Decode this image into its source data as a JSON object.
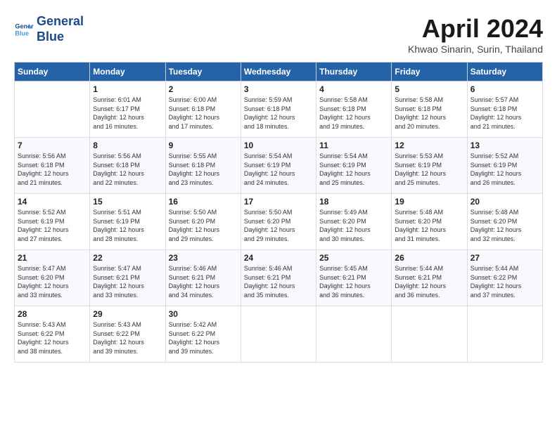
{
  "header": {
    "logo_line1": "General",
    "logo_line2": "Blue",
    "month_title": "April 2024",
    "subtitle": "Khwao Sinarin, Surin, Thailand"
  },
  "days_of_week": [
    "Sunday",
    "Monday",
    "Tuesday",
    "Wednesday",
    "Thursday",
    "Friday",
    "Saturday"
  ],
  "weeks": [
    [
      {
        "day": "",
        "detail": ""
      },
      {
        "day": "1",
        "detail": "Sunrise: 6:01 AM\nSunset: 6:17 PM\nDaylight: 12 hours\nand 16 minutes."
      },
      {
        "day": "2",
        "detail": "Sunrise: 6:00 AM\nSunset: 6:18 PM\nDaylight: 12 hours\nand 17 minutes."
      },
      {
        "day": "3",
        "detail": "Sunrise: 5:59 AM\nSunset: 6:18 PM\nDaylight: 12 hours\nand 18 minutes."
      },
      {
        "day": "4",
        "detail": "Sunrise: 5:58 AM\nSunset: 6:18 PM\nDaylight: 12 hours\nand 19 minutes."
      },
      {
        "day": "5",
        "detail": "Sunrise: 5:58 AM\nSunset: 6:18 PM\nDaylight: 12 hours\nand 20 minutes."
      },
      {
        "day": "6",
        "detail": "Sunrise: 5:57 AM\nSunset: 6:18 PM\nDaylight: 12 hours\nand 21 minutes."
      }
    ],
    [
      {
        "day": "7",
        "detail": "Sunrise: 5:56 AM\nSunset: 6:18 PM\nDaylight: 12 hours\nand 21 minutes."
      },
      {
        "day": "8",
        "detail": "Sunrise: 5:56 AM\nSunset: 6:18 PM\nDaylight: 12 hours\nand 22 minutes."
      },
      {
        "day": "9",
        "detail": "Sunrise: 5:55 AM\nSunset: 6:18 PM\nDaylight: 12 hours\nand 23 minutes."
      },
      {
        "day": "10",
        "detail": "Sunrise: 5:54 AM\nSunset: 6:19 PM\nDaylight: 12 hours\nand 24 minutes."
      },
      {
        "day": "11",
        "detail": "Sunrise: 5:54 AM\nSunset: 6:19 PM\nDaylight: 12 hours\nand 25 minutes."
      },
      {
        "day": "12",
        "detail": "Sunrise: 5:53 AM\nSunset: 6:19 PM\nDaylight: 12 hours\nand 25 minutes."
      },
      {
        "day": "13",
        "detail": "Sunrise: 5:52 AM\nSunset: 6:19 PM\nDaylight: 12 hours\nand 26 minutes."
      }
    ],
    [
      {
        "day": "14",
        "detail": "Sunrise: 5:52 AM\nSunset: 6:19 PM\nDaylight: 12 hours\nand 27 minutes."
      },
      {
        "day": "15",
        "detail": "Sunrise: 5:51 AM\nSunset: 6:19 PM\nDaylight: 12 hours\nand 28 minutes."
      },
      {
        "day": "16",
        "detail": "Sunrise: 5:50 AM\nSunset: 6:20 PM\nDaylight: 12 hours\nand 29 minutes."
      },
      {
        "day": "17",
        "detail": "Sunrise: 5:50 AM\nSunset: 6:20 PM\nDaylight: 12 hours\nand 29 minutes."
      },
      {
        "day": "18",
        "detail": "Sunrise: 5:49 AM\nSunset: 6:20 PM\nDaylight: 12 hours\nand 30 minutes."
      },
      {
        "day": "19",
        "detail": "Sunrise: 5:48 AM\nSunset: 6:20 PM\nDaylight: 12 hours\nand 31 minutes."
      },
      {
        "day": "20",
        "detail": "Sunrise: 5:48 AM\nSunset: 6:20 PM\nDaylight: 12 hours\nand 32 minutes."
      }
    ],
    [
      {
        "day": "21",
        "detail": "Sunrise: 5:47 AM\nSunset: 6:20 PM\nDaylight: 12 hours\nand 33 minutes."
      },
      {
        "day": "22",
        "detail": "Sunrise: 5:47 AM\nSunset: 6:21 PM\nDaylight: 12 hours\nand 33 minutes."
      },
      {
        "day": "23",
        "detail": "Sunrise: 5:46 AM\nSunset: 6:21 PM\nDaylight: 12 hours\nand 34 minutes."
      },
      {
        "day": "24",
        "detail": "Sunrise: 5:46 AM\nSunset: 6:21 PM\nDaylight: 12 hours\nand 35 minutes."
      },
      {
        "day": "25",
        "detail": "Sunrise: 5:45 AM\nSunset: 6:21 PM\nDaylight: 12 hours\nand 36 minutes."
      },
      {
        "day": "26",
        "detail": "Sunrise: 5:44 AM\nSunset: 6:21 PM\nDaylight: 12 hours\nand 36 minutes."
      },
      {
        "day": "27",
        "detail": "Sunrise: 5:44 AM\nSunset: 6:22 PM\nDaylight: 12 hours\nand 37 minutes."
      }
    ],
    [
      {
        "day": "28",
        "detail": "Sunrise: 5:43 AM\nSunset: 6:22 PM\nDaylight: 12 hours\nand 38 minutes."
      },
      {
        "day": "29",
        "detail": "Sunrise: 5:43 AM\nSunset: 6:22 PM\nDaylight: 12 hours\nand 39 minutes."
      },
      {
        "day": "30",
        "detail": "Sunrise: 5:42 AM\nSunset: 6:22 PM\nDaylight: 12 hours\nand 39 minutes."
      },
      {
        "day": "",
        "detail": ""
      },
      {
        "day": "",
        "detail": ""
      },
      {
        "day": "",
        "detail": ""
      },
      {
        "day": "",
        "detail": ""
      }
    ]
  ]
}
